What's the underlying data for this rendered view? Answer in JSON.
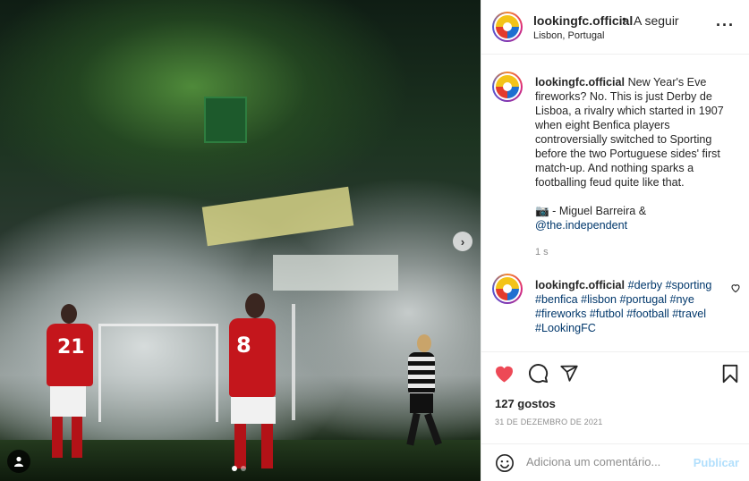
{
  "post": {
    "username": "lookingfc.official",
    "follow_label": "A seguir",
    "separator": "•",
    "location": "Lisbon, Portugal",
    "more_icon": "more-horizontal-icon"
  },
  "photo": {
    "jersey_numbers": [
      "21",
      "8"
    ],
    "carousel_total": 2,
    "carousel_active": 1
  },
  "caption": {
    "username": "lookingfc.official",
    "lines": [
      "New Year's Eve",
      "fireworks? No. This is just Derby de",
      "Lisboa, a rivalry which started in 1907",
      "when eight Benfica players",
      "controversially switched to Sporting",
      "before the two Portuguese sides' first",
      "match-up. And nothing sparks a",
      "footballing feud quite like that."
    ],
    "credit_icon": "📷",
    "credit": " - Miguel Barreira &",
    "credit_link": "@the.independent",
    "time": "1 s"
  },
  "comment": {
    "username": "lookingfc.official",
    "hashtags_line1": "#derby #sporting",
    "hashtags_line2": "#benfica #lisbon #portugal #nye",
    "hashtags_line3": "#fireworks #futbol #football #travel",
    "hashtags_line4": "#LookingFC"
  },
  "stats": {
    "likes": "127 gostos",
    "date": "31 DE DEZEMBRO DE 2021"
  },
  "compose": {
    "placeholder": "Adiciona um comentário...",
    "post_label": "Publicar"
  },
  "colors": {
    "like_red": "#ed4956",
    "link_blue": "#00376b",
    "publish_disabled": "#b2dffc"
  }
}
